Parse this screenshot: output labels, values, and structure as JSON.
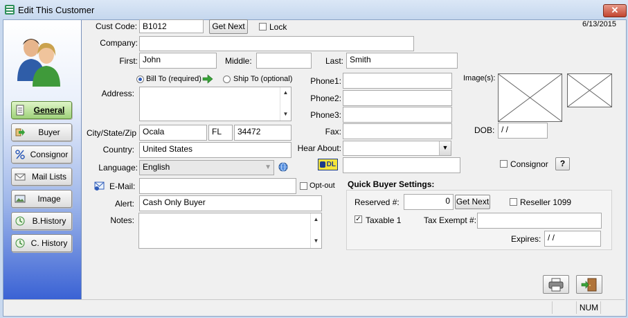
{
  "window": {
    "title": "Edit This Customer",
    "close_glyph": "✕"
  },
  "date": "6/13/2015",
  "sidebar": {
    "items": [
      {
        "label": "General",
        "icon": "document-icon"
      },
      {
        "label": "Buyer",
        "icon": "arrow-right-icon"
      },
      {
        "label": "Consignor",
        "icon": "percent-icon"
      },
      {
        "label": "Mail Lists",
        "icon": "envelope-icon"
      },
      {
        "label": "Image",
        "icon": "picture-icon"
      },
      {
        "label": "B.History",
        "icon": "history-icon"
      },
      {
        "label": "C. History",
        "icon": "history-icon"
      }
    ]
  },
  "form": {
    "cust_code_label": "Cust Code:",
    "cust_code": "B1012",
    "get_next_label": "Get Next",
    "lock_label": "Lock",
    "company_label": "Company:",
    "company": "",
    "first_label": "First:",
    "first": "John",
    "middle_label": "Middle:",
    "middle": "",
    "last_label": "Last:",
    "last": "Smith",
    "bill_to_label": "Bill To (required)",
    "ship_to_label": "Ship To (optional)",
    "address_label": "Address:",
    "address": "",
    "city_state_zip_label": "City/State/Zip",
    "city": "Ocala",
    "state": "FL",
    "zip": "34472",
    "country_label": "Country:",
    "country": "United States",
    "language_label": "Language:",
    "language": "English",
    "email_label": "E-Mail:",
    "email": "",
    "opt_out_label": "Opt-out",
    "alert_label": "Alert:",
    "alert": "Cash Only Buyer",
    "notes_label": "Notes:",
    "notes": "",
    "phone1_label": "Phone1:",
    "phone2_label": "Phone2:",
    "phone3_label": "Phone3:",
    "fax_label": "Fax:",
    "hear_about_label": "Hear About:",
    "phone1": "",
    "phone2": "",
    "phone3": "",
    "fax": "",
    "hear_about": "",
    "dl_badge": "DL",
    "dl_number": "",
    "images_label": "Image(s):",
    "dob_label": "DOB:",
    "dob": " / /",
    "consignor_label": "Consignor",
    "help_label": "?"
  },
  "quick_buyer": {
    "title": "Quick Buyer Settings:",
    "reserved_label": "Reserved #:",
    "reserved_value": "0",
    "get_next_label": "Get Next",
    "reseller_label": "Reseller 1099",
    "taxable_label": "Taxable 1",
    "taxable_checked": true,
    "tax_exempt_label": "Tax Exempt #:",
    "tax_exempt": "",
    "expires_label": "Expires:",
    "expires": " / /"
  },
  "status": {
    "num": "NUM"
  },
  "colors": {
    "accent": "#2e5bb8",
    "active_nav": "#9fd27a",
    "close": "#c2452f"
  }
}
